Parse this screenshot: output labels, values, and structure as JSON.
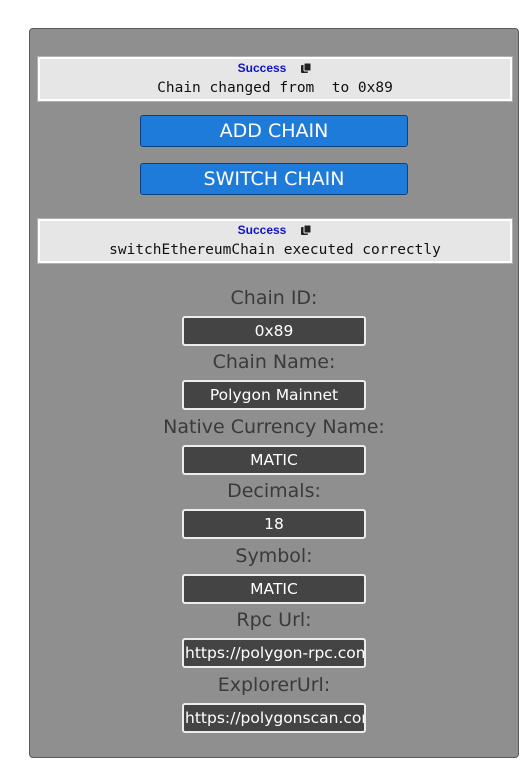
{
  "notices": [
    {
      "title": "Success",
      "message": "Chain changed from  to 0x89",
      "icon": "copy-icon"
    },
    {
      "title": "Success",
      "message": "switchEthereumChain executed correctly",
      "icon": "copy-icon"
    }
  ],
  "buttons": {
    "add_chain": "ADD CHAIN",
    "switch_chain": "SWITCH CHAIN"
  },
  "fields": {
    "chain_id": {
      "label": "Chain ID:",
      "value": "0x89"
    },
    "chain_name": {
      "label": "Chain Name:",
      "value": "Polygon Mainnet"
    },
    "native_currency_name": {
      "label": "Native Currency Name:",
      "value": "MATIC"
    },
    "decimals": {
      "label": "Decimals:",
      "value": "18"
    },
    "symbol": {
      "label": "Symbol:",
      "value": "MATIC"
    },
    "rpc_url": {
      "label": "Rpc Url:",
      "value": "https://polygon-rpc.com"
    },
    "explorer_url": {
      "label": "ExplorerUrl:",
      "value": "https://polygonscan.com"
    }
  },
  "colors": {
    "panel_bg": "#8f8f8f",
    "button_bg": "#1f7bd9",
    "success_title": "#1212c9",
    "field_bg": "#444444"
  }
}
